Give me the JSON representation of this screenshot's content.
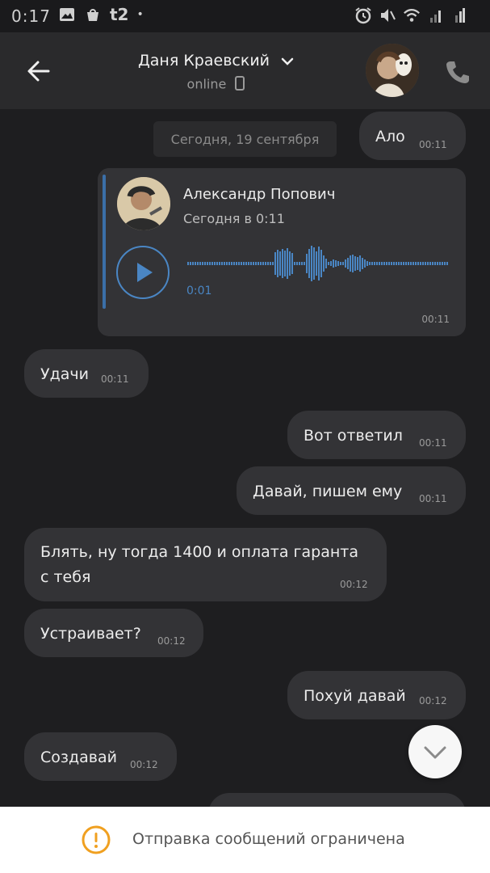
{
  "status_bar": {
    "time": "0:17",
    "carrier": "t2",
    "icons_left": [
      "image-icon",
      "shopping-bag-icon"
    ],
    "icons_right": [
      "alarm-icon",
      "mute-icon",
      "wifi-icon",
      "signal-icon",
      "signal-icon-2"
    ]
  },
  "header": {
    "contact_name": "Даня Краевский",
    "status": "online",
    "accent": "#4a86c4"
  },
  "chat": {
    "date_separator": "Сегодня, 19 сентября",
    "voice_message": {
      "sender": "Александр Попович",
      "sent_at": "Сегодня в 0:11",
      "duration": "0:01",
      "time": "00:11"
    },
    "messages": [
      {
        "text": "Ало",
        "time": "00:11",
        "outgoing": true
      },
      {
        "text": "Удачи",
        "time": "00:11",
        "outgoing": false
      },
      {
        "text": "Вот ответил",
        "time": "00:11",
        "outgoing": true
      },
      {
        "text": "Давай, пишем ему",
        "time": "00:11",
        "outgoing": true
      },
      {
        "text_line1": "Блять, ну тогда 1400 и оплата гаранта",
        "text_line2": "с тебя",
        "time": "00:12",
        "outgoing": false
      },
      {
        "text": "Устраивает?",
        "time": "00:12",
        "outgoing": false
      },
      {
        "text": "Похуй давай",
        "time": "00:12",
        "outgoing": true
      },
      {
        "text": "Создавай",
        "time": "00:12",
        "outgoing": false
      }
    ]
  },
  "restriction": {
    "text": "Отправка сообщений ограничена",
    "icon_color": "#f0a020"
  }
}
